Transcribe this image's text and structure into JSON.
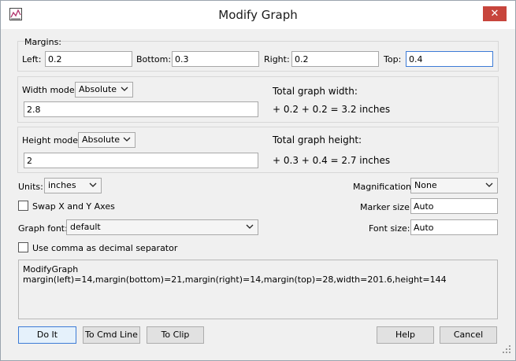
{
  "window": {
    "title": "Modify Graph",
    "close_symbol": "✕"
  },
  "margins": {
    "group_label": "Margins:",
    "left_label": "Left:",
    "left_value": "0.2",
    "bottom_label": "Bottom:",
    "bottom_value": "0.3",
    "right_label": "Right:",
    "right_value": "0.2",
    "top_label": "Top:",
    "top_value": "0.4"
  },
  "width": {
    "mode_label": "Width mode:",
    "mode_value": "Absolute",
    "value": "2.8",
    "total_label": "Total graph width:",
    "total_formula": "+ 0.2 + 0.2 = 3.2 inches"
  },
  "height": {
    "mode_label": "Height mode:",
    "mode_value": "Absolute",
    "value": "2",
    "total_label": "Total graph height:",
    "total_formula": "+ 0.3 + 0.4 = 2.7 inches"
  },
  "options": {
    "units_label": "Units:",
    "units_value": "inches",
    "swap_label": "Swap X and Y Axes",
    "swap_checked": false,
    "font_label": "Graph font:",
    "font_value": "default",
    "comma_label": "Use comma as decimal separator",
    "comma_checked": false,
    "magnification_label": "Magnification:",
    "magnification_value": "None",
    "marker_label": "Marker size:",
    "marker_value": "Auto",
    "fontsize_label": "Font size:",
    "fontsize_value": "Auto"
  },
  "command": {
    "text": "ModifyGraph margin(left)=14,margin(bottom)=21,margin(right)=14,margin(top)=28,width=201.6,height=144"
  },
  "buttons": {
    "do_it": "Do It",
    "to_cmd_line": "To Cmd Line",
    "to_clip": "To Clip",
    "help": "Help",
    "cancel": "Cancel"
  },
  "colors": {
    "close_button": "#c7453c",
    "focus_border": "#3d7bd6",
    "dialog_background": "#f0f0f0"
  },
  "icons": {
    "app": "graph-app-icon",
    "close": "close-icon",
    "dropdown": "chevron-down-icon",
    "resize": "resize-grip-icon"
  }
}
